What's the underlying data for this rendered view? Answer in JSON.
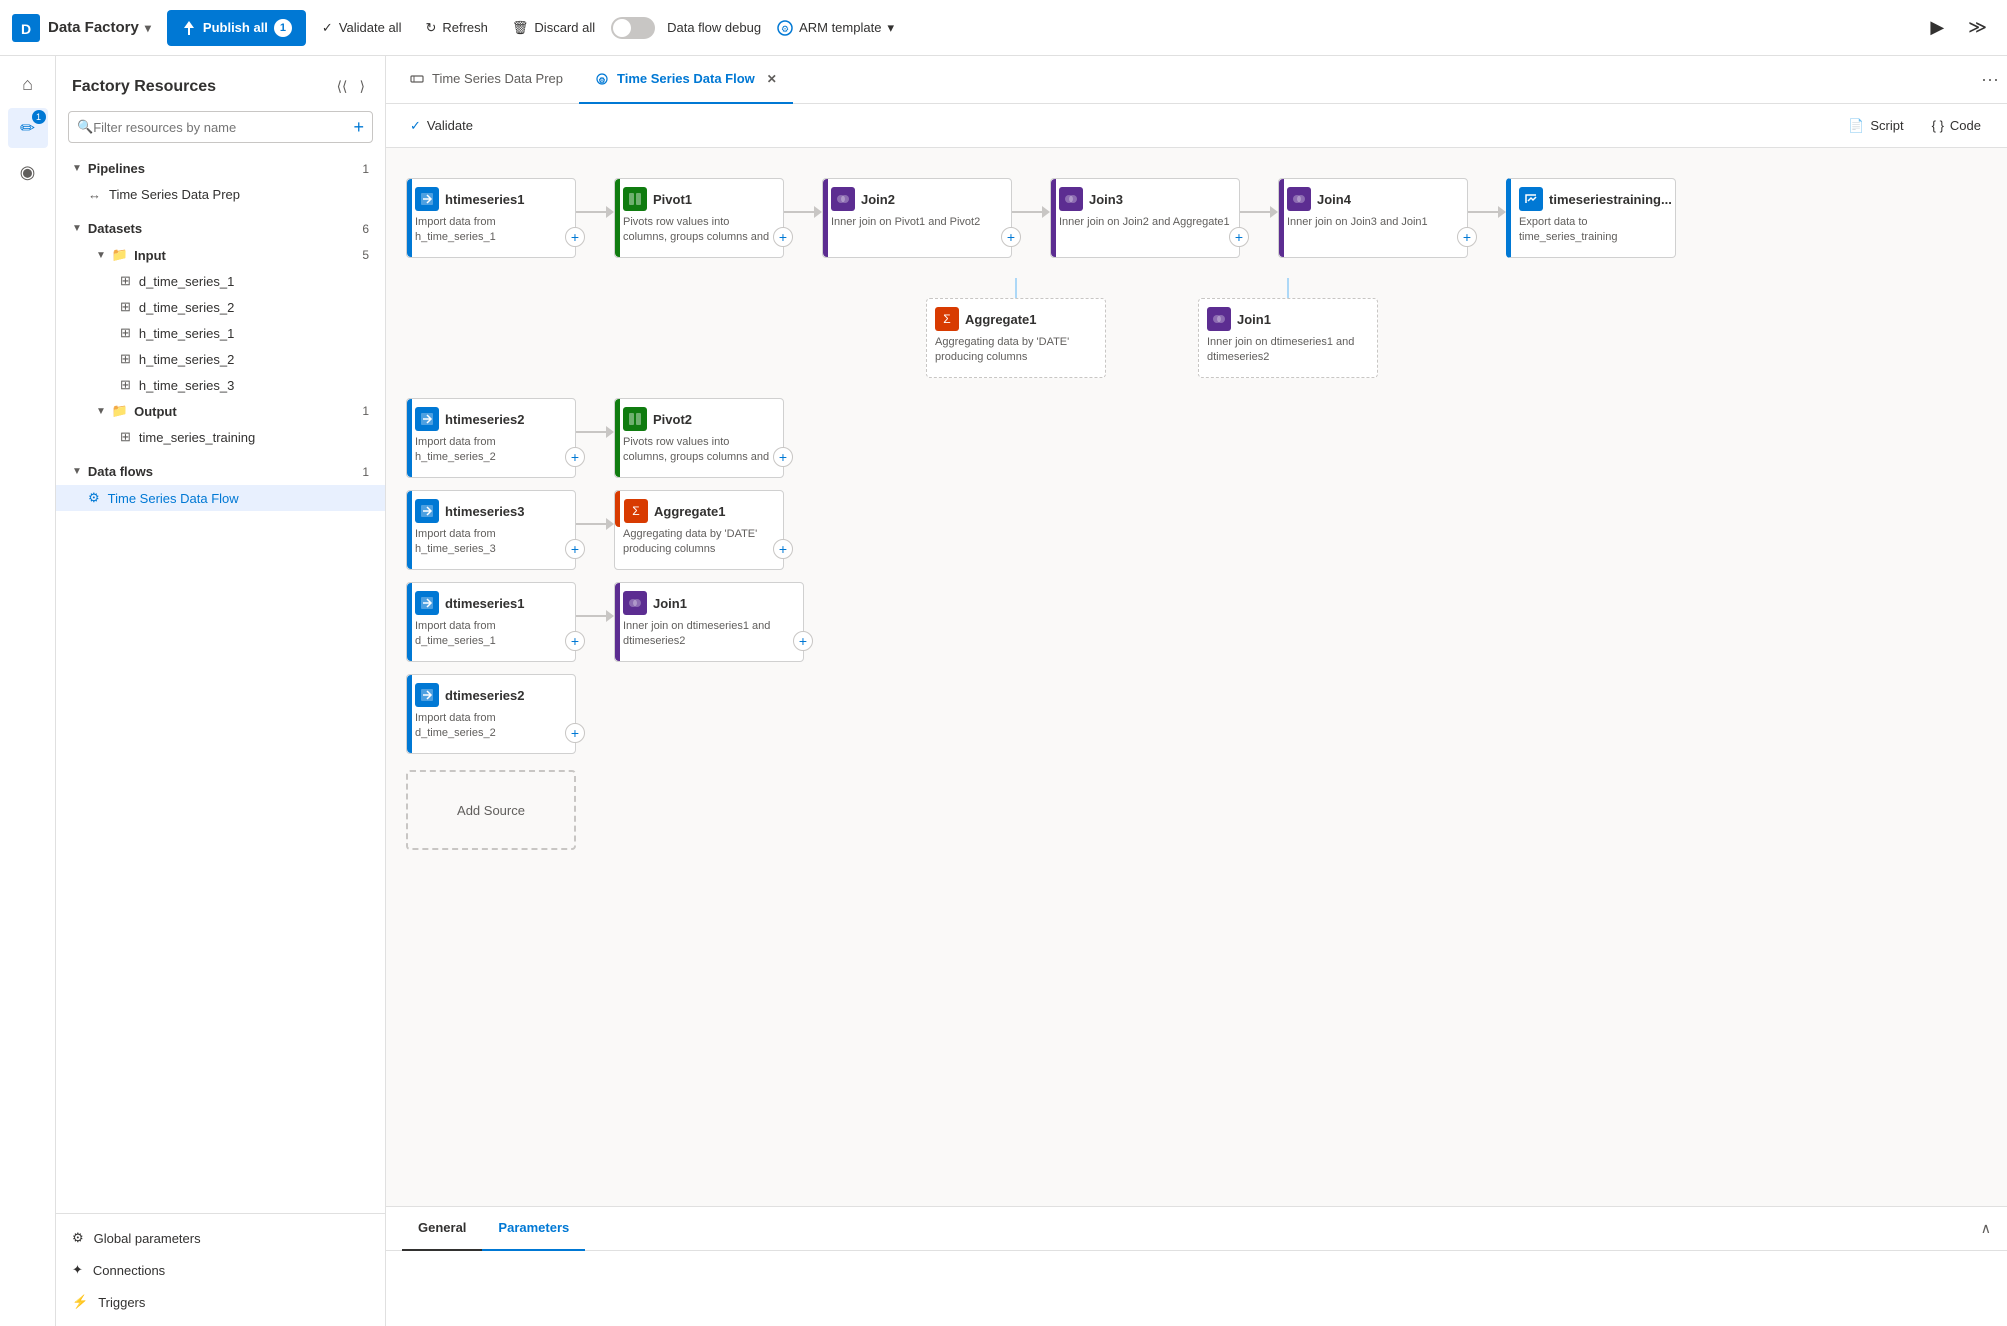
{
  "app": {
    "title": "Data Factory",
    "badge": "1"
  },
  "topbar": {
    "publish_label": "Publish all",
    "publish_badge": "1",
    "validate_label": "Validate all",
    "refresh_label": "Refresh",
    "discard_label": "Discard all",
    "debug_label": "Data flow debug",
    "arm_label": "ARM template"
  },
  "sidebar": {
    "title": "Factory Resources",
    "search_placeholder": "Filter resources by name",
    "sections": [
      {
        "id": "pipelines",
        "label": "Pipelines",
        "count": "1",
        "items": [
          {
            "label": "Time Series Data Prep",
            "icon": "pipeline"
          }
        ]
      },
      {
        "id": "datasets",
        "label": "Datasets",
        "count": "6",
        "folders": [
          {
            "label": "Input",
            "count": "5",
            "items": [
              "d_time_series_1",
              "d_time_series_2",
              "h_time_series_1",
              "h_time_series_2",
              "h_time_series_3"
            ]
          },
          {
            "label": "Output",
            "count": "1",
            "items": [
              "time_series_training"
            ]
          }
        ]
      },
      {
        "id": "dataflows",
        "label": "Data flows",
        "count": "1",
        "items": [
          {
            "label": "Time Series Data Flow",
            "icon": "dataflow",
            "active": true
          }
        ]
      }
    ],
    "bottom_items": [
      {
        "id": "global-params",
        "label": "Global parameters",
        "icon": "settings"
      },
      {
        "id": "connections",
        "label": "Connections",
        "icon": "connections"
      },
      {
        "id": "triggers",
        "label": "Triggers",
        "icon": "triggers"
      }
    ]
  },
  "tabs": [
    {
      "id": "tab-prep",
      "label": "Time Series Data Prep",
      "active": false,
      "closable": false
    },
    {
      "id": "tab-flow",
      "label": "Time Series Data Flow",
      "active": true,
      "closable": true
    }
  ],
  "actions": {
    "validate_label": "Validate",
    "script_label": "Script",
    "code_label": "Code"
  },
  "canvas": {
    "rows": [
      {
        "id": "row1",
        "nodes": [
          {
            "id": "htimeseries1",
            "title": "htimeseries1",
            "body": "Import data from h_time_series_1",
            "color": "blue",
            "has_add": true
          },
          {
            "id": "pivot1",
            "title": "Pivot1",
            "body": "Pivots row values into columns, groups columns and",
            "color": "green",
            "has_add": true
          },
          {
            "id": "join2",
            "title": "Join2",
            "body": "Inner join on Pivot1 and Pivot2",
            "color": "purple",
            "has_add": true
          },
          {
            "id": "join3",
            "title": "Join3",
            "body": "Inner join on Join2 and Aggregate1",
            "color": "purple",
            "has_add": true
          },
          {
            "id": "join4",
            "title": "Join4",
            "body": "Inner join on Join3 and Join1",
            "color": "purple",
            "has_add": true
          },
          {
            "id": "timeseriestraining",
            "title": "timeseriestraining...",
            "body": "Export data to time_series_training",
            "color": "blue",
            "has_add": false
          }
        ]
      }
    ],
    "side_nodes": {
      "aggregate1": {
        "title": "Aggregate1",
        "body": "Aggregating data by 'DATE' producing columns",
        "color": "orange"
      },
      "join1_top": {
        "title": "Join1",
        "body": "Inner join on dtimeseries1 and dtimeseries2",
        "color": "purple"
      }
    },
    "row2": [
      {
        "id": "htimeseries2",
        "title": "htimeseries2",
        "body": "Import data from h_time_series_2",
        "color": "blue",
        "has_add": true
      },
      {
        "id": "pivot2",
        "title": "Pivot2",
        "body": "Pivots row values into columns, groups columns and",
        "color": "green",
        "has_add": true
      }
    ],
    "row3": [
      {
        "id": "htimeseries3",
        "title": "htimeseries3",
        "body": "Import data from h_time_series_3",
        "color": "blue",
        "has_add": true
      },
      {
        "id": "aggregate1",
        "title": "Aggregate1",
        "body": "Aggregating data by 'DATE' producing columns",
        "color": "orange",
        "has_add": true
      }
    ],
    "row4": [
      {
        "id": "dtimeseries1",
        "title": "dtimeseries1",
        "body": "Import data from d_time_series_1",
        "color": "blue",
        "has_add": true
      },
      {
        "id": "join1",
        "title": "Join1",
        "body": "Inner join on dtimeseries1 and dtimeseries2",
        "color": "purple",
        "has_add": true
      }
    ],
    "row5": [
      {
        "id": "dtimeseries2",
        "title": "dtimeseries2",
        "body": "Import data from d_time_series_2",
        "color": "blue",
        "has_add": true
      }
    ],
    "add_source_label": "Add Source"
  },
  "bottom": {
    "tabs": [
      {
        "label": "General",
        "active": true
      },
      {
        "label": "Parameters",
        "active": false,
        "blue": true
      }
    ]
  },
  "icons": {
    "search": "🔍",
    "add": "+",
    "chevron_down": "▾",
    "chevron_right": "▸",
    "chevron_left": "◂",
    "collapse": "⟨⟨",
    "expand": "⟩⟩",
    "pipeline": "↔",
    "dataset": "⊞",
    "folder": "📁",
    "dataflow": "⚙",
    "gear": "⚙",
    "connections": "✦",
    "trigger": "⚡",
    "validate": "✓",
    "script": "📄",
    "code": "{ }",
    "more": "···",
    "play": "▶",
    "zoom_in": "+",
    "zoom_out": "−",
    "fit": "⊡",
    "zoom_search": "🔍",
    "home": "⌂",
    "monitor": "◉",
    "pencil": "✏"
  }
}
